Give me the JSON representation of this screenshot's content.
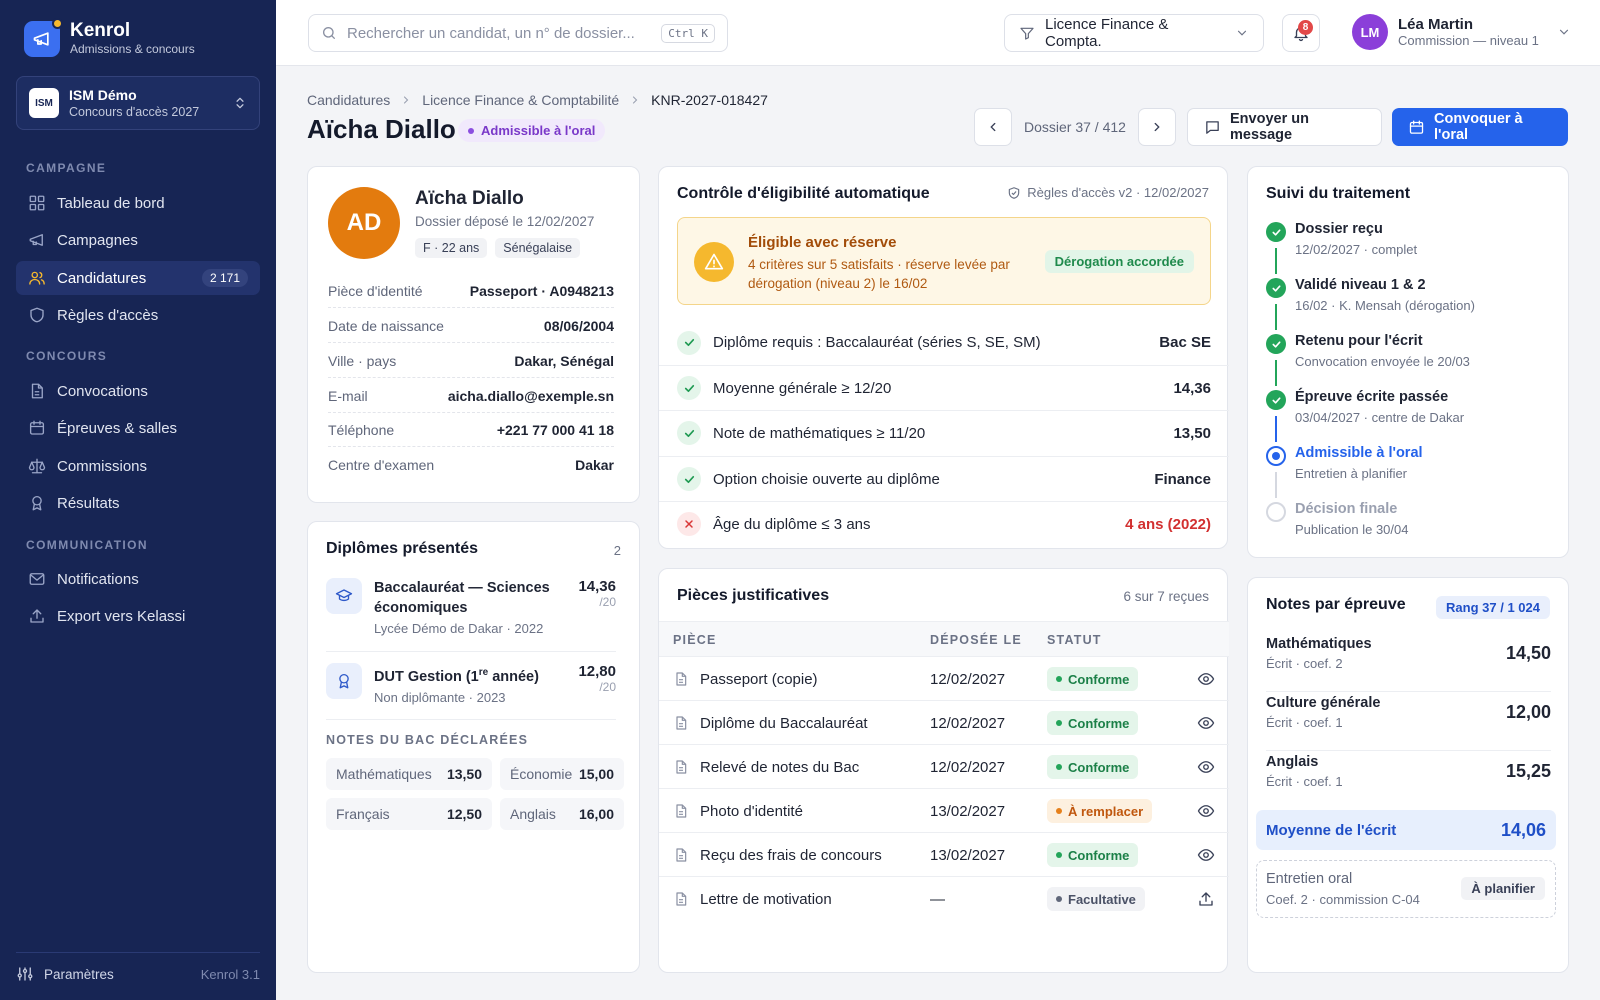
{
  "brand": {
    "name": "Kenrol",
    "subtitle": "Admissions & concours"
  },
  "org": {
    "logo": "ISM",
    "name": "ISM Démo",
    "subtitle": "Concours d'accès 2027"
  },
  "nav": {
    "sections": {
      "campagne": "CAMPAGNE",
      "concours": "CONCOURS",
      "communication": "COMMUNICATION"
    },
    "items": [
      {
        "label": "Tableau de bord",
        "icon": "dashboard-icon"
      },
      {
        "label": "Campagnes",
        "icon": "megaphone-icon"
      },
      {
        "label": "Candidatures",
        "icon": "users-icon",
        "badge": "2 171",
        "active": true
      },
      {
        "label": "Règles d'accès",
        "icon": "shield-icon"
      },
      {
        "label": "Convocations",
        "icon": "document-icon"
      },
      {
        "label": "Épreuves & salles",
        "icon": "calendar-icon"
      },
      {
        "label": "Commissions",
        "icon": "scales-icon"
      },
      {
        "label": "Résultats",
        "icon": "award-icon"
      },
      {
        "label": "Notifications",
        "icon": "mail-icon"
      },
      {
        "label": "Export vers Kelassi",
        "icon": "upload-icon"
      }
    ],
    "settings": "Paramètres",
    "version": "Kenrol 3.1"
  },
  "topbar": {
    "search_placeholder": "Rechercher un candidat, un n° de dossier...",
    "search_shortcut": "Ctrl K",
    "filter": "Licence Finance & Compta.",
    "notif_count": "8",
    "user": {
      "initials": "LM",
      "name": "Léa Martin",
      "role": "Commission — niveau 1"
    }
  },
  "header": {
    "breadcrumb": [
      "Candidatures",
      "Licence Finance & Comptabilité",
      "KNR-2027-018427"
    ],
    "title": "Aïcha Diallo",
    "status": "Admissible à l'oral",
    "pager": "Dossier 37 / 412",
    "message_btn": "Envoyer un message",
    "convoke_btn": "Convoquer à l'oral"
  },
  "identity": {
    "initials": "AD",
    "name": "Aïcha Diallo",
    "deposit": "Dossier déposé le 12/02/2027",
    "tags": [
      "F · 22 ans",
      "Sénégalaise"
    ],
    "fields": [
      {
        "k": "Pièce d'identité",
        "v": "Passeport · A0948213"
      },
      {
        "k": "Date de naissance",
        "v": "08/06/2004"
      },
      {
        "k": "Ville · pays",
        "v": "Dakar, Sénégal"
      },
      {
        "k": "E-mail",
        "v": "aicha.diallo@exemple.sn"
      },
      {
        "k": "Téléphone",
        "v": "+221 77 000 41 18"
      },
      {
        "k": "Centre d'examen",
        "v": "Dakar"
      }
    ]
  },
  "diplomas": {
    "title": "Diplômes présentés",
    "count": "2",
    "items": [
      {
        "title": "Baccalauréat — Sciences économiques",
        "sub": "Lycée Démo de Dakar · 2022",
        "score": "14,36",
        "denom": "/20",
        "icon": "graduation-cap-icon"
      },
      {
        "title_pre": "DUT Gestion (1",
        "title_sup": "re",
        "title_post": " année)",
        "sub": "Non diplômante · 2023",
        "score": "12,80",
        "denom": "/20",
        "icon": "award-icon"
      }
    ],
    "bac_title": "NOTES DU BAC DÉCLARÉES",
    "bac_grades": [
      {
        "k": "Mathématiques",
        "v": "13,50"
      },
      {
        "k": "Économie",
        "v": "15,00"
      },
      {
        "k": "Français",
        "v": "12,50"
      },
      {
        "k": "Anglais",
        "v": "16,00"
      }
    ]
  },
  "eligibility": {
    "title": "Contrôle d'éligibilité automatique",
    "rules": "Règles d'accès v2 · 12/02/2027",
    "alert": {
      "title": "Éligible avec réserve",
      "text": "4 critères sur 5 satisfaits · réserve levée par dérogation (niveau 2) le 16/02",
      "badge": "Dérogation accordée"
    },
    "criteria": [
      {
        "label": "Diplôme requis : Baccalauréat (séries S, SE, SM)",
        "value": "Bac SE",
        "ok": true
      },
      {
        "label": "Moyenne générale ≥ 12/20",
        "value": "14,36",
        "ok": true
      },
      {
        "label": "Note de mathématiques ≥ 11/20",
        "value": "13,50",
        "ok": true
      },
      {
        "label": "Option choisie ouverte au diplôme",
        "value": "Finance",
        "ok": true
      },
      {
        "label": "Âge du diplôme ≤ 3 ans",
        "value": "4 ans (2022)",
        "ok": false
      }
    ]
  },
  "documents": {
    "title": "Pièces justificatives",
    "count": "6 sur 7 reçues",
    "headers": [
      "PIÈCE",
      "DÉPOSÉE LE",
      "STATUT"
    ],
    "rows": [
      {
        "name": "Passeport (copie)",
        "date": "12/02/2027",
        "status": "Conforme",
        "kind": "ok",
        "action": "eye-icon"
      },
      {
        "name": "Diplôme du Baccalauréat",
        "date": "12/02/2027",
        "status": "Conforme",
        "kind": "ok",
        "action": "eye-icon"
      },
      {
        "name": "Relevé de notes du Bac",
        "date": "12/02/2027",
        "status": "Conforme",
        "kind": "ok",
        "action": "eye-icon"
      },
      {
        "name": "Photo d'identité",
        "date": "13/02/2027",
        "status": "À remplacer",
        "kind": "warn",
        "action": "eye-icon"
      },
      {
        "name": "Reçu des frais de concours",
        "date": "13/02/2027",
        "status": "Conforme",
        "kind": "ok",
        "action": "eye-icon"
      },
      {
        "name": "Lettre de motivation",
        "date": "—",
        "status": "Facultative",
        "kind": "neutral",
        "action": "upload-icon"
      }
    ]
  },
  "timeline": {
    "title": "Suivi du traitement",
    "steps": [
      {
        "title": "Dossier reçu",
        "sub": "12/02/2027 · complet",
        "state": "done"
      },
      {
        "title": "Validé niveau 1 & 2",
        "sub": "16/02 · K. Mensah (dérogation)",
        "state": "done"
      },
      {
        "title": "Retenu pour l'écrit",
        "sub": "Convocation envoyée le 20/03",
        "state": "done"
      },
      {
        "title": "Épreuve écrite passée",
        "sub": "03/04/2027 · centre de Dakar",
        "state": "done"
      },
      {
        "title": "Admissible à l'oral",
        "sub": "Entretien à planifier",
        "state": "current"
      },
      {
        "title": "Décision finale",
        "sub": "Publication le 30/04",
        "state": "todo"
      }
    ]
  },
  "scores": {
    "title": "Notes par épreuve",
    "rank": "Rang 37 / 1 024",
    "items": [
      {
        "name": "Mathématiques",
        "sub": "Écrit · coef. 2",
        "value": "14,50"
      },
      {
        "name": "Culture générale",
        "sub": "Écrit · coef. 1",
        "value": "12,00"
      },
      {
        "name": "Anglais",
        "sub": "Écrit · coef. 1",
        "value": "15,25"
      }
    ],
    "average_label": "Moyenne de l'écrit",
    "average_value": "14,06",
    "oral": {
      "name": "Entretien oral",
      "sub": "Coef. 2 · commission C-04",
      "badge": "À planifier"
    }
  },
  "colors": {
    "sidebar": "#172554",
    "primary": "#2563eb",
    "accent": "#f5b82e",
    "success": "#23a55a",
    "danger": "#d93636"
  }
}
